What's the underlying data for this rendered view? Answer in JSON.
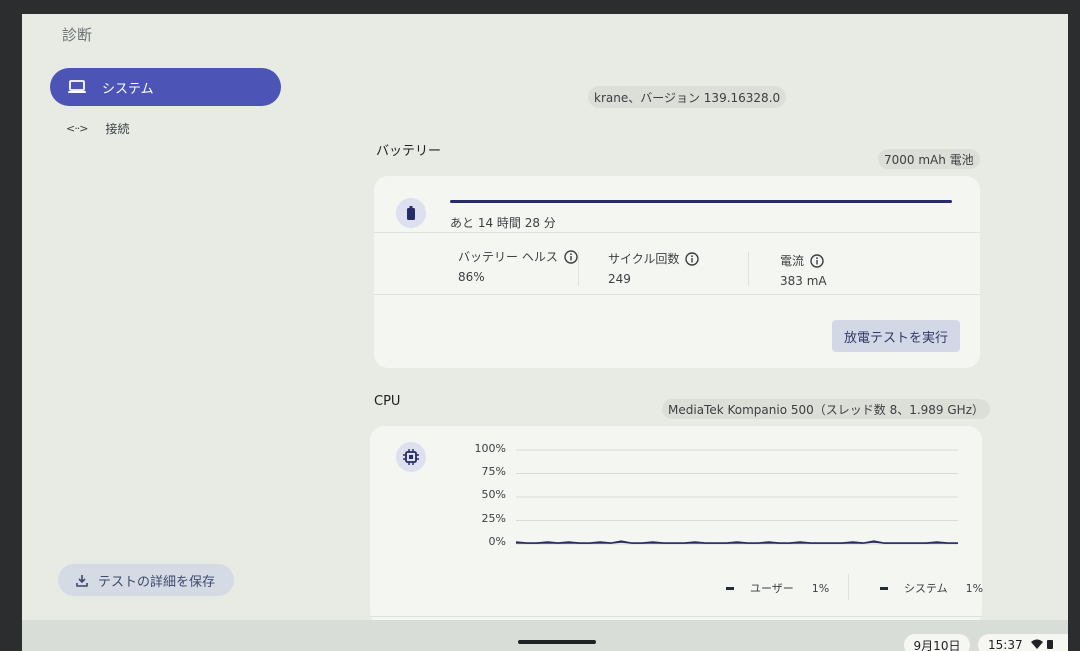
{
  "app": {
    "title": "診断"
  },
  "sidebar": {
    "items": [
      {
        "label": "システム",
        "icon": "laptop-icon",
        "active": true
      },
      {
        "label": "接続",
        "icon": "connection-arrows-icon",
        "active": false
      }
    ],
    "save_button": {
      "label": "テストの詳細を保存",
      "icon": "download-icon"
    }
  },
  "system": {
    "version": "krane、バージョン 139.16328.0"
  },
  "battery": {
    "title": "バッテリー",
    "capacity_chip": "7000 mAh 電池",
    "icon": "battery-icon",
    "time_left": "あと 14 時間 28 分",
    "charge_fraction": 1.0,
    "metrics": [
      {
        "label": "バッテリー ヘルス",
        "value": "86%"
      },
      {
        "label": "サイクル回数",
        "value": "249"
      },
      {
        "label": "電流",
        "value": "383 mA"
      }
    ],
    "discharge_button": "放電テストを実行"
  },
  "cpu": {
    "title": "CPU",
    "chip": "MediaTek Kompanio 500（スレッド数 8、1.989 GHz）",
    "icon": "cpu-chip-icon",
    "legend": [
      {
        "name": "ユーザー",
        "value": "1%"
      },
      {
        "name": "システム",
        "value": "1%"
      }
    ]
  },
  "chart_data": {
    "type": "line",
    "title": "",
    "xlabel": "",
    "ylabel": "",
    "ylim": [
      0,
      100
    ],
    "yticks": [
      "100%",
      "75%",
      "50%",
      "25%",
      "0%"
    ],
    "grid": true,
    "series": [
      {
        "name": "ユーザー",
        "values": [
          2,
          1,
          1,
          2,
          1,
          2,
          1,
          1,
          2,
          1,
          3,
          1,
          1,
          2,
          1,
          1,
          1,
          2,
          1,
          1,
          1,
          2,
          1,
          1,
          2,
          1,
          1,
          2,
          1,
          1,
          1,
          1,
          2,
          1,
          3,
          1,
          1,
          1,
          1,
          1,
          2,
          1,
          1
        ]
      },
      {
        "name": "システム",
        "values": [
          1,
          1,
          1,
          1,
          1,
          1,
          1,
          1,
          1,
          1,
          2,
          1,
          1,
          1,
          1,
          1,
          1,
          1,
          1,
          1,
          1,
          1,
          1,
          1,
          1,
          1,
          1,
          1,
          1,
          1,
          1,
          1,
          1,
          1,
          2,
          1,
          1,
          1,
          1,
          1,
          1,
          1,
          1
        ]
      }
    ],
    "colors": {
      "user": "#262b6a",
      "system": "#3c4043"
    }
  },
  "shelf": {
    "date": "9月10日",
    "time": "15:37",
    "icons": [
      "wifi-icon",
      "battery-status-icon"
    ]
  }
}
